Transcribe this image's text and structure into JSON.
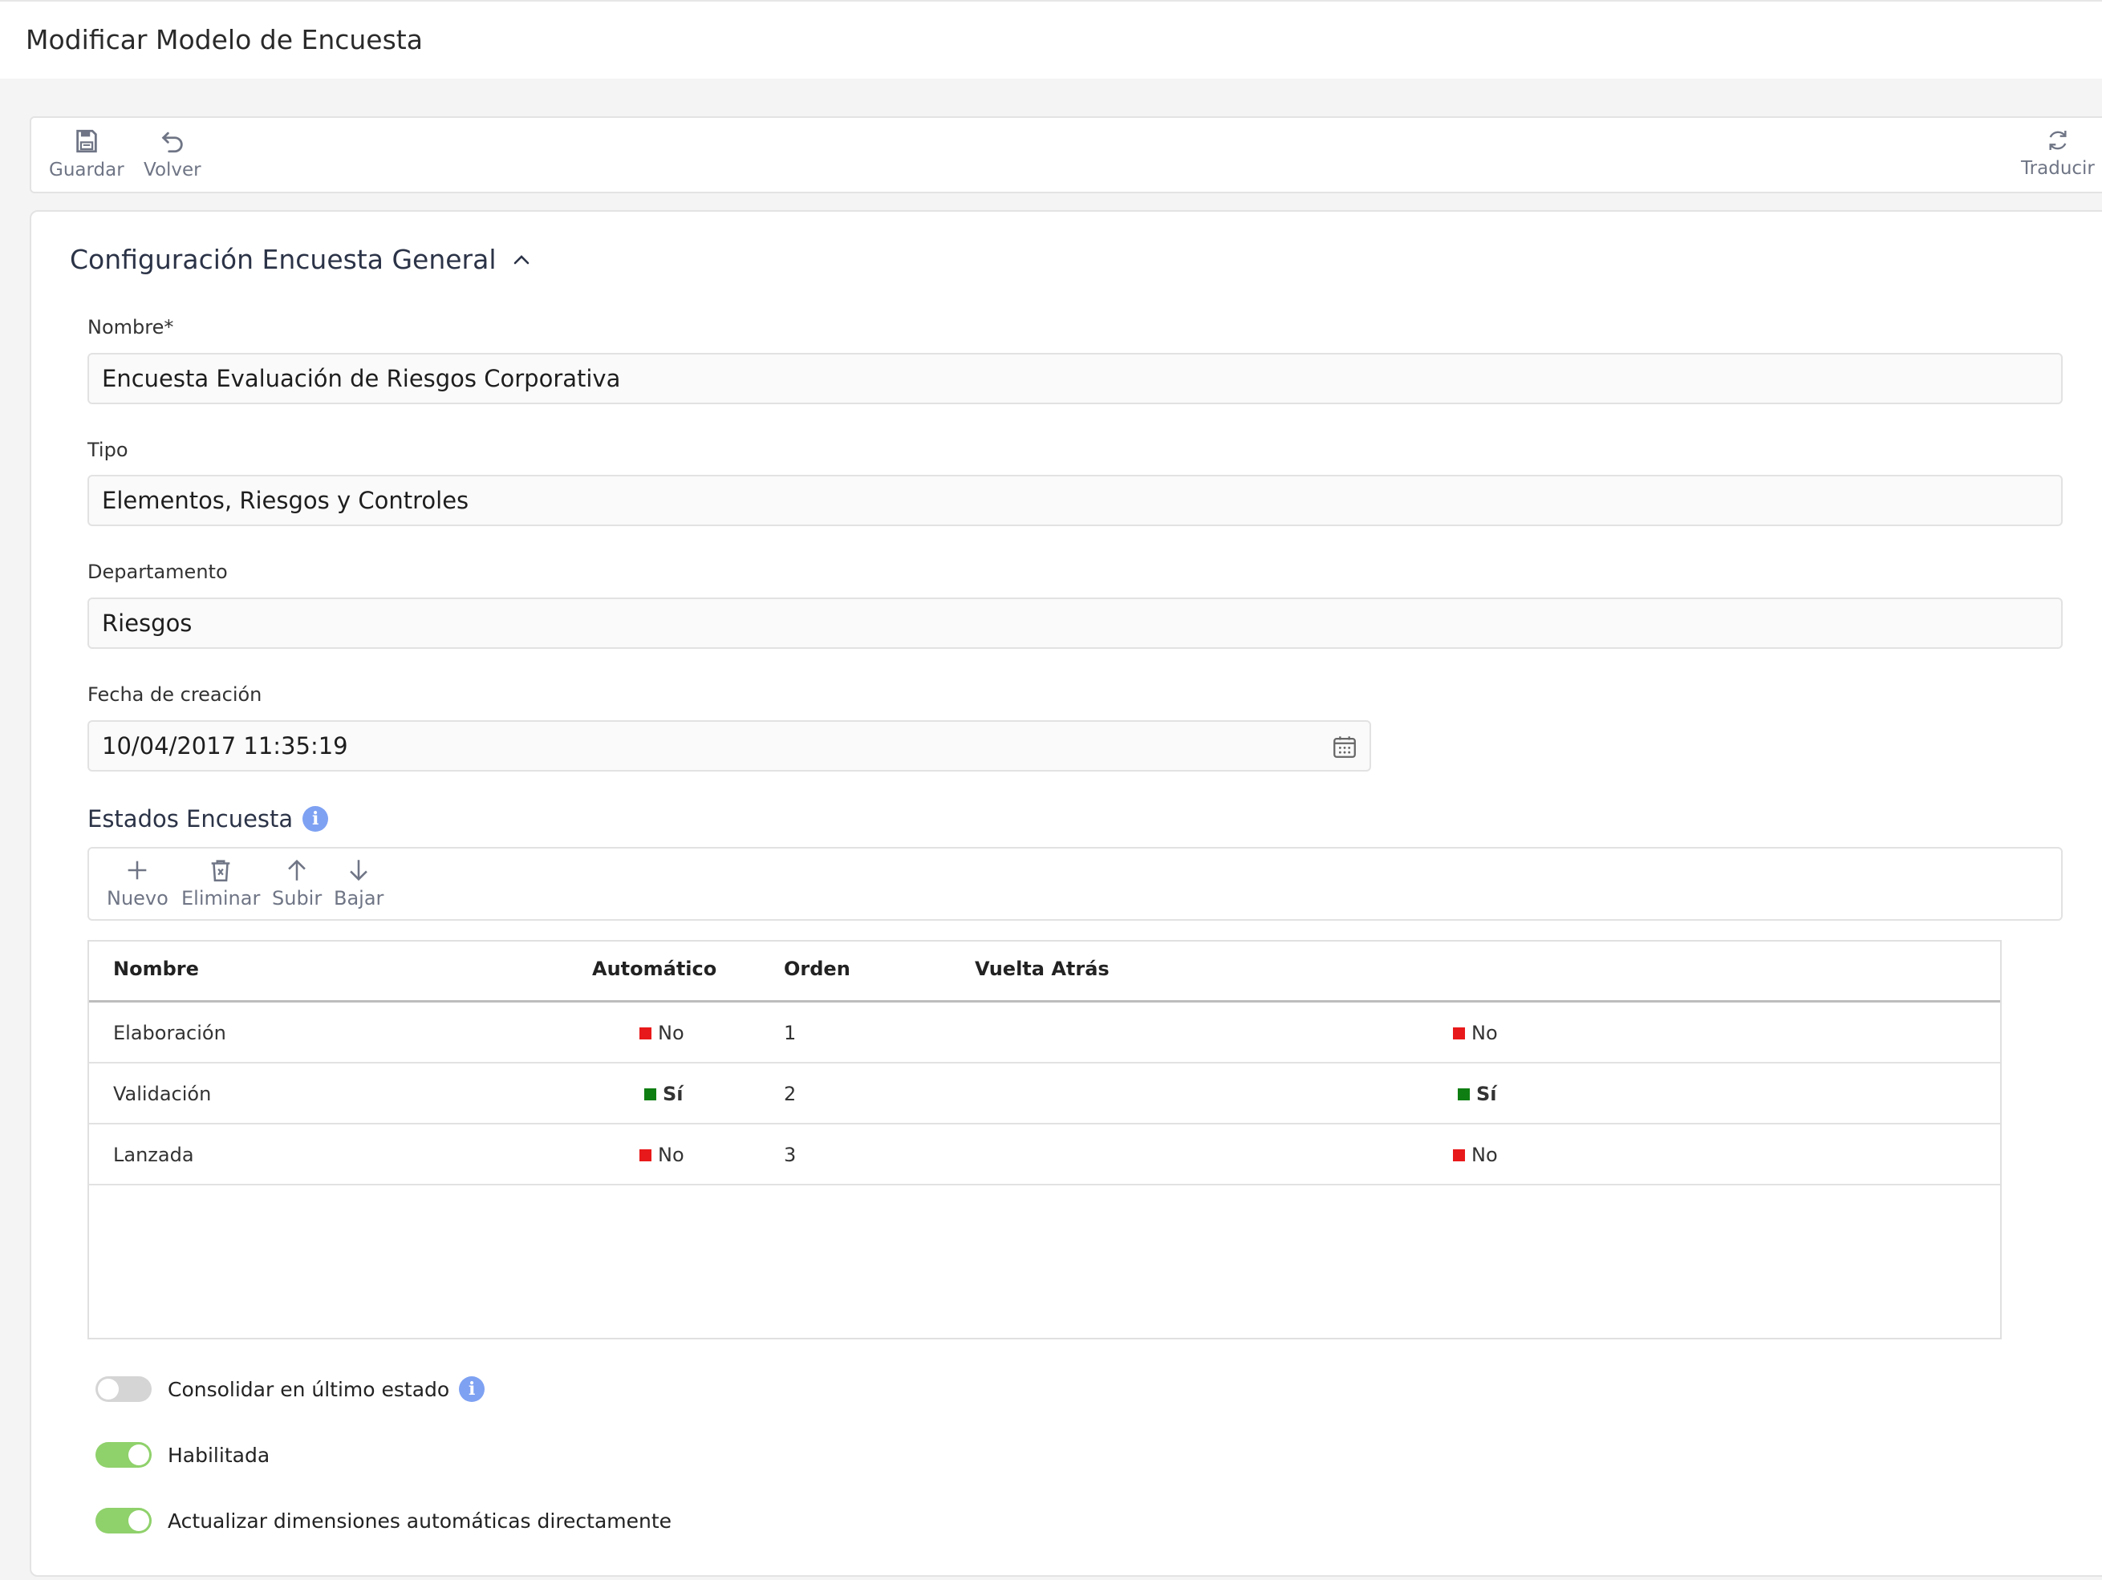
{
  "page": {
    "title": "Modificar Modelo de Encuesta"
  },
  "toolbar": {
    "save_label": "Guardar",
    "back_label": "Volver",
    "translate_label": "Traducir"
  },
  "section": {
    "title": "Configuración Encuesta General"
  },
  "form": {
    "name": {
      "label": "Nombre*",
      "value": "Encuesta Evaluación de Riesgos Corporativa"
    },
    "type": {
      "label": "Tipo",
      "value": "Elementos, Riesgos y Controles"
    },
    "department": {
      "label": "Departamento",
      "value": "Riesgos"
    },
    "created": {
      "label": "Fecha de creación",
      "value": "10/04/2017 11:35:19"
    }
  },
  "states": {
    "title": "Estados Encuesta",
    "actions": {
      "new": "Nuevo",
      "delete": "Eliminar",
      "up": "Subir",
      "down": "Bajar"
    },
    "columns": [
      "Nombre",
      "Automático",
      "Orden",
      "Vuelta Atrás"
    ],
    "rows": [
      {
        "name": "Elaboración",
        "auto": "No",
        "order": "1",
        "back": "No"
      },
      {
        "name": "Validación",
        "auto": "Sí",
        "order": "2",
        "back": "Sí"
      },
      {
        "name": "Lanzada",
        "auto": "No",
        "order": "3",
        "back": "No"
      }
    ]
  },
  "toggles": {
    "consolidate": {
      "label": "Consolidar en último estado",
      "on": false
    },
    "enabled": {
      "label": "Habilitada",
      "on": true
    },
    "update_dims": {
      "label": "Actualizar dimensiones automáticas directamente",
      "on": true
    }
  },
  "colors": {
    "no": "#e8191a",
    "yes": "#0e7e12",
    "toggle_on": "#8fd16b",
    "info": "#7ea1f2"
  }
}
